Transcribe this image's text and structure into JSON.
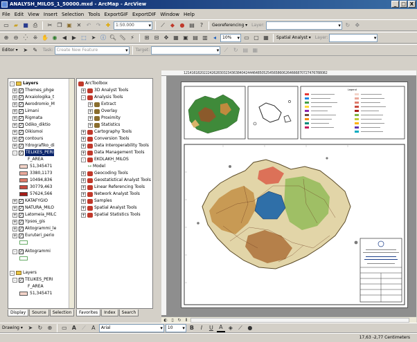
{
  "window": {
    "title": "ANALYSH_MILOS_1_50000.mxd - ArcMap - ArcView",
    "buttons": [
      "_",
      "□",
      "X"
    ]
  },
  "menubar": [
    "File",
    "Edit",
    "View",
    "Insert",
    "Selection",
    "Tools",
    "ExportGIF",
    "ExportDIF",
    "Window",
    "Help"
  ],
  "toolbar1": {
    "scale_value": "1:50.000",
    "georeferencing_label": "Georeferencing ▾",
    "georef_layer_label": "Layer:"
  },
  "toolbar2": {
    "zoom_value": "10%",
    "spatial_analyst_label": "Spatial Analyst ▾",
    "sa_layer_label": "Layer:"
  },
  "toolbar3": {
    "editor_label": "Editor ▾",
    "task_label": "Task:",
    "task_value": "Create New Feature",
    "target_label": "Target:"
  },
  "toc": {
    "root_label": "Layers",
    "layers": [
      {
        "name": "Themes_phge",
        "checked": true
      },
      {
        "name": "Arxaiologika_t",
        "checked": true
      },
      {
        "name": "Aerodromio_M",
        "checked": true
      },
      {
        "name": "Limani",
        "checked": true
      },
      {
        "name": "Rigmata",
        "checked": true
      },
      {
        "name": "Odiko_diktio",
        "checked": true
      },
      {
        "name": "Oikismoi",
        "checked": true
      },
      {
        "name": "contours",
        "checked": true
      },
      {
        "name": "Ydrografiko_di",
        "checked": true
      }
    ],
    "selected_layer": "TELIKES_PERI",
    "field_label": "F_AREA",
    "classes": [
      {
        "label": "51,345471",
        "color": "#f3d3c8"
      },
      {
        "label": "3380,1173",
        "color": "#e9a89a"
      },
      {
        "label": "10494,836",
        "color": "#de7b6a"
      },
      {
        "label": "30779,463",
        "color": "#c94a3e"
      },
      {
        "label": "57624,566",
        "color": "#a61b16"
      }
    ],
    "layers_after": [
      {
        "name": "KATAFYGIO",
        "checked": true
      },
      {
        "name": "NATURA_MILO",
        "checked": true
      },
      {
        "name": "Latomeia_MILC",
        "checked": true
      },
      {
        "name": "Ypsos_gis",
        "checked": true
      },
      {
        "name": "Aktogrammi_le",
        "checked": true
      },
      {
        "name": "Euruteri_perio",
        "checked": true
      }
    ],
    "aktogrammi_label": "Aktogrammi",
    "root2_label": "Layers",
    "root2_layer": "TELIKES_PERI",
    "root2_field": "F_AREA",
    "root2_class": "51,345471"
  },
  "toc_tabs": [
    "Display",
    "Source",
    "Selection"
  ],
  "arctoolbox": {
    "root": "ArcToolbox",
    "items": [
      {
        "label": "3D Analyst Tools",
        "exp": "+",
        "level": 0
      },
      {
        "label": "Analysis Tools",
        "exp": "-",
        "level": 0
      },
      {
        "label": "Extract",
        "exp": "+",
        "level": 1
      },
      {
        "label": "Overlay",
        "exp": "+",
        "level": 1
      },
      {
        "label": "Proximity",
        "exp": "+",
        "level": 1
      },
      {
        "label": "Statistics",
        "exp": "+",
        "level": 1
      },
      {
        "label": "Cartography Tools",
        "exp": "+",
        "level": 0
      },
      {
        "label": "Conversion Tools",
        "exp": "+",
        "level": 0
      },
      {
        "label": "Data Interoperability Tools",
        "exp": "+",
        "level": 0
      },
      {
        "label": "Data Management Tools",
        "exp": "+",
        "level": 0
      },
      {
        "label": "EKOLAKH_MILOS",
        "exp": "-",
        "level": 0
      },
      {
        "label": "Model",
        "exp": "",
        "level": 1
      },
      {
        "label": "Geocoding Tools",
        "exp": "+",
        "level": 0
      },
      {
        "label": "Geostatistical Analyst Tools",
        "exp": "+",
        "level": 0
      },
      {
        "label": "Linear Referencing Tools",
        "exp": "+",
        "level": 0
      },
      {
        "label": "Network Analyst Tools",
        "exp": "+",
        "level": 0
      },
      {
        "label": "Samples",
        "exp": "+",
        "level": 0
      },
      {
        "label": "Spatial Analyst Tools",
        "exp": "+",
        "level": 0
      },
      {
        "label": "Spatial Statistics Tools",
        "exp": "+",
        "level": 0
      }
    ]
  },
  "toolbox_tabs": [
    "Favorites",
    "Index",
    "Search"
  ],
  "ruler_text": "121416182022242628303234363840424446485052545658606264666870727476788082",
  "map": {
    "legend_title": "Legend"
  },
  "drawing_toolbar": {
    "drawing_label": "Drawing ▾",
    "font_name": "Arial",
    "font_size": "10",
    "bold": "B",
    "italic": "I",
    "underline": "U",
    "font_color": "A"
  },
  "status": {
    "coordinates": "17,63 -2,77 Centimeters"
  }
}
